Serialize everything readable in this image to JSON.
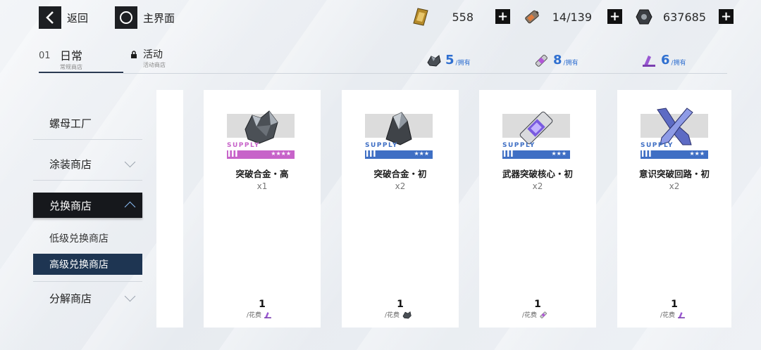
{
  "topbar": {
    "back_label": "返回",
    "home_label": "主界面",
    "resources": [
      {
        "icon": "gold-ticket-icon",
        "value": "558"
      },
      {
        "icon": "battery-icon",
        "value": "14/139"
      },
      {
        "icon": "coin-nut-icon",
        "value": "637685"
      }
    ]
  },
  "tabs": {
    "daily_num": "01",
    "daily_main": "日常",
    "daily_sub": "常规商店",
    "event_main": "活动",
    "event_sub": "活动商店"
  },
  "owned": [
    {
      "icon": "ore-icon",
      "count": "5",
      "unit": "/拥有"
    },
    {
      "icon": "core-capsule-icon",
      "count": "8",
      "unit": "/拥有"
    },
    {
      "icon": "circuit-icon",
      "count": "6",
      "unit": "/拥有"
    }
  ],
  "sidebar": {
    "items": [
      {
        "label": "螺母工厂"
      },
      {
        "label": "涂装商店"
      },
      {
        "label": "兑换商店"
      },
      {
        "label": "低级兑换商店"
      },
      {
        "label": "高级兑换商店"
      },
      {
        "label": "分解商店"
      }
    ]
  },
  "cards": [
    {
      "name": "突破合金・高",
      "qty": "x1",
      "supply": "SUPPLY",
      "stars": "★★★★",
      "rarity_color": "#c763c9",
      "price": "1",
      "cost_label": "/花费",
      "cost_icon": "circuit-icon"
    },
    {
      "name": "突破合金・初",
      "qty": "x2",
      "supply": "SUPPLY",
      "stars": "★★★",
      "rarity_color": "#3f6fc4",
      "price": "1",
      "cost_label": "/花费",
      "cost_icon": "ore-icon"
    },
    {
      "name": "武器突破核心・初",
      "qty": "x2",
      "supply": "SUPPLY",
      "stars": "★★★",
      "rarity_color": "#3f6fc4",
      "price": "1",
      "cost_label": "/花费",
      "cost_icon": "core-capsule-icon"
    },
    {
      "name": "意识突破回路・初",
      "qty": "x2",
      "supply": "SUPPLY",
      "stars": "★★★",
      "rarity_color": "#3f6fc4",
      "price": "1",
      "cost_label": "/花费",
      "cost_icon": "circuit-icon"
    }
  ]
}
